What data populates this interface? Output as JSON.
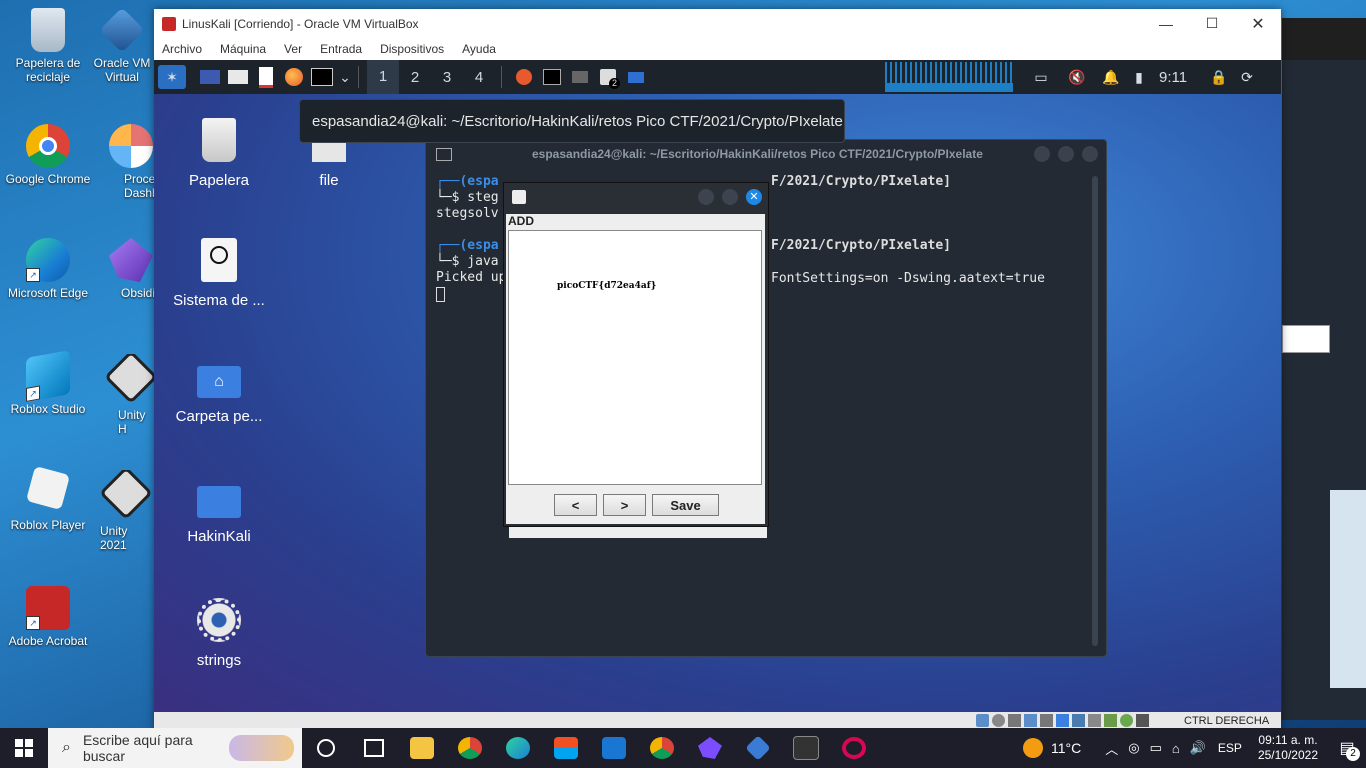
{
  "windows_desktop": {
    "icons": [
      {
        "label": "Papelera de reciclaje"
      },
      {
        "label": "Oracle VM Virtual"
      },
      {
        "label": "Google Chrome"
      },
      {
        "label": "Proce Dashbo"
      },
      {
        "label": "Microsoft Edge"
      },
      {
        "label": "Obsidi"
      },
      {
        "label": "Roblox Studio"
      },
      {
        "label": "Unity H"
      },
      {
        "label": "Roblox Player"
      },
      {
        "label": "Unity 2021"
      },
      {
        "label": "Adobe Acrobat"
      }
    ]
  },
  "virtualbox": {
    "title": "LinusKali [Corriendo] - Oracle VM VirtualBox",
    "menu": [
      "Archivo",
      "Máquina",
      "Ver",
      "Entrada",
      "Dispositivos",
      "Ayuda"
    ],
    "status_text": "CTRL DERECHA"
  },
  "kali_panel": {
    "workspaces": [
      "1",
      "2",
      "3",
      "4"
    ],
    "active_workspace": "1",
    "clock": "9:11",
    "badge_count": "2"
  },
  "tooltip": "espasandia24@kali: ~/Escritorio/HakinKali/retos Pico CTF/2021/Crypto/PIxelate",
  "kali_desktop": {
    "icons": [
      {
        "label": "Papelera"
      },
      {
        "label": "file"
      },
      {
        "label": "Sistema de ..."
      },
      {
        "label": "Carpeta pe..."
      },
      {
        "label": "HakinKali"
      },
      {
        "label": "strings"
      }
    ]
  },
  "terminal": {
    "title": "espasandia24@kali: ~/Escritorio/HakinKali/retos Pico CTF/2021/Crypto/PIxelate",
    "lines": [
      "┌──(espa",
      "└─$ steg",
      "stegsolv",
      "",
      "┌──(espa",
      "└─$ java",
      "Picked up"
    ],
    "right_fragments": [
      "F/2021/Crypto/PIxelate]",
      "F/2021/Crypto/PIxelate]",
      "FontSettings=on -Dswing.aatext=true"
    ]
  },
  "java_dialog": {
    "header": "ADD",
    "flag_text": "picoCTF{d72ea4af}",
    "buttons": {
      "prev": "<",
      "next": ">",
      "save": "Save"
    }
  },
  "taskbar": {
    "search_placeholder": "Escribe aquí para buscar",
    "weather": "11°C",
    "language": "ESP",
    "time": "09:11 a. m.",
    "date": "25/10/2022",
    "notification_count": "2"
  }
}
